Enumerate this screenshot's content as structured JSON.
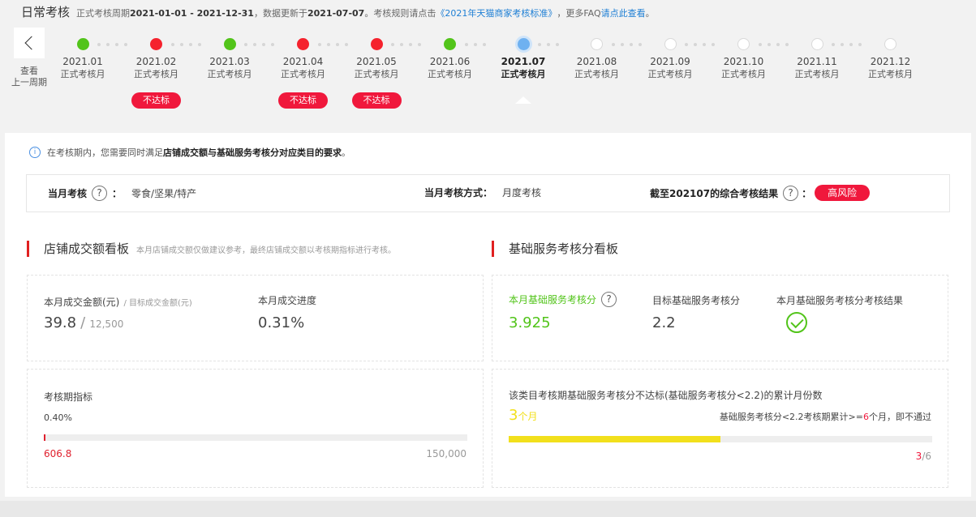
{
  "header": {
    "title": "日常考核",
    "period_prefix": "正式考核周期",
    "period_range": "2021-01-01 - 2021-12-31",
    "update_prefix": "，数据更新于",
    "update_date": "2021-07-07",
    "rule_prefix": "。考核规则请点击",
    "rule_link": "《2021年天猫商家考核标准》",
    "faq_prefix": "，更多FAQ",
    "faq_link": "请点此查看",
    "faq_suffix": "。"
  },
  "timeline": {
    "prev_label_1": "查看",
    "prev_label_2": "上一周期",
    "months": [
      {
        "label": "2021.01",
        "type": "正式考核月",
        "status": "green",
        "badge": ""
      },
      {
        "label": "2021.02",
        "type": "正式考核月",
        "status": "red",
        "badge": "不达标"
      },
      {
        "label": "2021.03",
        "type": "正式考核月",
        "status": "green",
        "badge": ""
      },
      {
        "label": "2021.04",
        "type": "正式考核月",
        "status": "red",
        "badge": "不达标"
      },
      {
        "label": "2021.05",
        "type": "正式考核月",
        "status": "red",
        "badge": "不达标"
      },
      {
        "label": "2021.06",
        "type": "正式考核月",
        "status": "green",
        "badge": ""
      },
      {
        "label": "2021.07",
        "type": "正式考核月",
        "status": "current",
        "badge": ""
      },
      {
        "label": "2021.08",
        "type": "正式考核月",
        "status": "future",
        "badge": ""
      },
      {
        "label": "2021.09",
        "type": "正式考核月",
        "status": "future",
        "badge": ""
      },
      {
        "label": "2021.10",
        "type": "正式考核月",
        "status": "future",
        "badge": ""
      },
      {
        "label": "2021.11",
        "type": "正式考核月",
        "status": "future",
        "badge": ""
      },
      {
        "label": "2021.12",
        "type": "正式考核月",
        "status": "future",
        "badge": ""
      }
    ]
  },
  "notice": {
    "prefix": "在考核期内，您需要同时满足",
    "bold": "店铺成交额与基础服务考核分对应类目的要求",
    "suffix": "。"
  },
  "summary": {
    "month_label": "当月考核",
    "month_value": "零食/坚果/特产",
    "method_label": "当月考核方式：",
    "method_value": "月度考核",
    "result_label": "截至202107的综合考核结果",
    "result_value": "高风险",
    "colon": "："
  },
  "gmv_board": {
    "title": "店铺成交额看板",
    "note": "本月店铺成交额仅做建议参考，最终店铺成交额以考核期指标进行考核。",
    "amount_label": "本月成交金额(元)",
    "target_label": "/ 目标成交金额(元)",
    "amount_value": "39.8",
    "slash": "/",
    "target_value": "12,500",
    "progress_label": "本月成交进度",
    "progress_value": "0.31%",
    "period_label": "考核期指标",
    "period_percent": "0.40%",
    "period_current": "606.8",
    "period_target": "150,000",
    "period_fill": 0.004
  },
  "service_board": {
    "title": "基础服务考核分看板",
    "score_label": "本月基础服务考核分",
    "score_value": "3.925",
    "target_label": "目标基础服务考核分",
    "target_value": "2.2",
    "result_label": "本月基础服务考核分考核结果",
    "fail_desc": "该类目考核期基础服务考核分不达标(基础服务考核分<2.2)的累计月份数",
    "fail_count": "3",
    "fail_unit": "个月",
    "rule_prefix": "基础服务考核分<2.2考核期累计>=",
    "rule_num": "6",
    "rule_suffix": "个月，即不通过",
    "ratio": "3/6",
    "fill": 0.5
  },
  "colors": {
    "green": "#52c41a",
    "red": "#f0183c",
    "blue_link": "#1e7fd4",
    "yellow": "#f2e01c",
    "accent_bar": "#e02020"
  }
}
